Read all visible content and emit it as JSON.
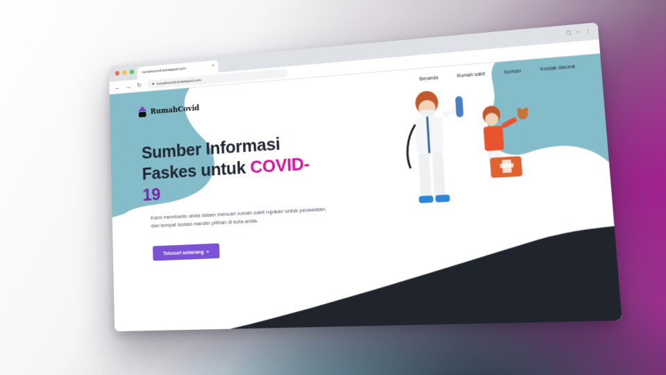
{
  "browser": {
    "tab_title": "rumahcovid.kotwaqod.com",
    "tab_close": "×",
    "address": "rumahcovid.kotwaqod.com",
    "menu_dots": "⋮",
    "bookmark_star": "☆"
  },
  "site": {
    "logo_text": "RumahCovid",
    "nav": [
      {
        "label": "Beranda"
      },
      {
        "label": "Rumah sakit"
      },
      {
        "label": "Isoman"
      },
      {
        "label": "Kontak darurat"
      }
    ],
    "hero": {
      "title_line1": "Sumber Informasi",
      "title_line2_prefix": "Faskes untuk ",
      "title_accent": "COVID-",
      "title_accent_2": "19",
      "description": "Kami membantu anda dalam mencari rumah sakit rujukan untuk perawatan, dan tempat isolasi mandiri pilihan di kota anda.",
      "cta_label": "Telusuri sekarang",
      "cta_icon": "»"
    }
  },
  "colors": {
    "accent_pink": "#d6129b",
    "accent_purple": "#7d1fb0",
    "cta_bg": "#7b52d6",
    "teal": "#84bcc9",
    "dark": "#1f242d"
  }
}
